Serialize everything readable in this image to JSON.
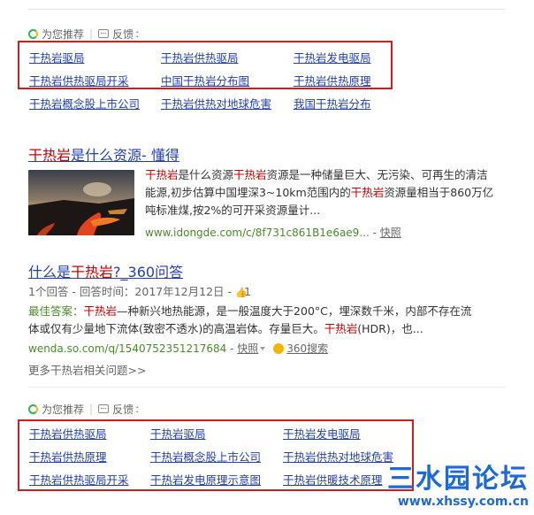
{
  "rec1": {
    "label": "为您推荐",
    "feedback": "反馈",
    "links": [
      "干热岩驱局",
      "干热岩供热驱局",
      "干热岩发电驱局",
      "干热岩供热驱局开采",
      "中国干热岩分布图",
      "干热岩供热原理",
      "干热岩概念股上市公司",
      "干热岩供热对地球危害",
      "我国干热岩分布"
    ]
  },
  "result1": {
    "title_hl": "干热岩",
    "title_rest": "是什么资源- 懂得",
    "snippet": [
      [
        {
          "t": "干热岩",
          "h": true
        },
        {
          "t": "是什么资源",
          "h": false
        },
        {
          "t": "干热岩",
          "h": true
        },
        {
          "t": "资源是一种储量巨大、无污染、可再生的清洁",
          "h": false
        }
      ],
      [
        {
          "t": "能源,初步估算中国埋深3~10km范围内的",
          "h": false
        },
        {
          "t": "干热岩",
          "h": true
        },
        {
          "t": "资源量相当于860万亿",
          "h": false
        }
      ],
      [
        {
          "t": "吨标准煤,按2%的可开采资源量计...",
          "h": false
        }
      ]
    ],
    "url": "www.idongde.com/c/8f731c861B1e6ae9...",
    "snapshot": "快照"
  },
  "result2": {
    "title_pre": "什么是",
    "title_hl": "干热岩",
    "title_post": "?_360问答",
    "meta": "1个回答 - 回答时间：2017年12月12日 - ",
    "likes": "1",
    "best_label": "最佳答案：",
    "snippet1": [
      {
        "t": "干热岩",
        "h": true
      },
      {
        "t": "—种新兴地热能源，是一般温度大于200°C，埋深数千米，内部不存在流",
        "h": false
      }
    ],
    "snippet2": [
      {
        "t": "体或仅有少量地下流体(致密不透水)的高温岩体。存量巨大。",
        "h": false
      },
      {
        "t": "干热岩",
        "h": true
      },
      {
        "t": "(HDR)，也...",
        "h": false
      }
    ],
    "url": "wenda.so.com/q/1540752351217684",
    "snapshot": "快照",
    "source": "360搜索"
  },
  "more": "更多干热岩相关问题>>",
  "rec2": {
    "label": "为您推荐",
    "feedback": "反馈",
    "links": [
      "干热岩供热驱局",
      "干热岩驱局",
      "干热岩发电驱局",
      "干热岩供热原理",
      "干热岩概念股上市公司",
      "干热岩供热对地球危害",
      "干热岩供热驱局开采",
      "干热岩发电原理示意图",
      "干热岩供暖技术原理"
    ]
  },
  "watermark": {
    "main": "三水园论坛",
    "url": "www.xhssy.com.cn"
  },
  "colors": {
    "link": "#2440b3",
    "highlight": "#cc0000",
    "box": "#d41c1c",
    "url_green": "#4a8a2c",
    "watermark": "#1d6ad7"
  }
}
